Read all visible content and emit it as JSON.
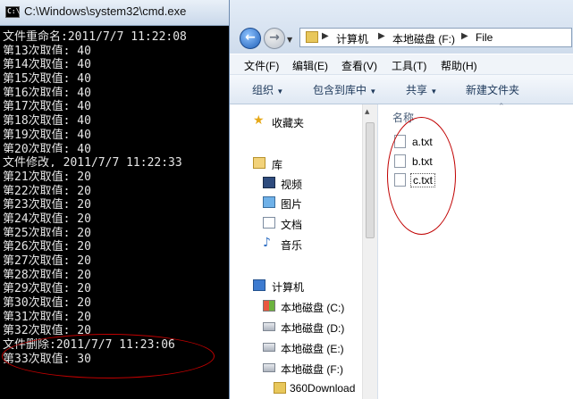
{
  "cmd": {
    "title": "C:\\Windows\\system32\\cmd.exe",
    "icon_text": "C:\\",
    "lines": [
      "文件重命名:2011/7/7 11:22:08",
      "第13次取值: 40",
      "第14次取值: 40",
      "第15次取值: 40",
      "第16次取值: 40",
      "第17次取值: 40",
      "第18次取值: 40",
      "第19次取值: 40",
      "第20次取值: 40",
      "文件修改, 2011/7/7 11:22:33",
      "第21次取值: 20",
      "第22次取值: 20",
      "第23次取值: 20",
      "第24次取值: 20",
      "第25次取值: 20",
      "第26次取值: 20",
      "第27次取值: 20",
      "第28次取值: 20",
      "第29次取值: 20",
      "第30次取值: 20",
      "第31次取值: 20",
      "第32次取值: 20",
      "文件删除:2011/7/7 11:23:06",
      "第33次取值: 30"
    ]
  },
  "explorer": {
    "breadcrumb": [
      "计算机",
      "本地磁盘 (F:)",
      "File"
    ],
    "menu": [
      "文件(F)",
      "编辑(E)",
      "查看(V)",
      "工具(T)",
      "帮助(H)"
    ],
    "toolbar": [
      "组织",
      "包含到库中",
      "共享",
      "新建文件夹"
    ],
    "nav": [
      {
        "label": "收藏夹",
        "icon": "star-icon"
      },
      {
        "label": "库",
        "icon": "library-icon"
      },
      {
        "label": "视频",
        "icon": "video-icon"
      },
      {
        "label": "图片",
        "icon": "picture-icon"
      },
      {
        "label": "文档",
        "icon": "document-icon"
      },
      {
        "label": "音乐",
        "icon": "music-icon"
      },
      {
        "label": "计算机",
        "icon": "computer-icon"
      },
      {
        "label": "本地磁盘 (C:)",
        "icon": "system-drive-icon"
      },
      {
        "label": "本地磁盘 (D:)",
        "icon": "drive-icon"
      },
      {
        "label": "本地磁盘 (E:)",
        "icon": "drive-icon"
      },
      {
        "label": "本地磁盘 (F:)",
        "icon": "drive-icon"
      },
      {
        "label": "360Download",
        "icon": "folder-icon"
      }
    ],
    "column_name": "名称",
    "files": [
      "a.txt",
      "b.txt",
      "c.txt"
    ],
    "selected_file": "c.txt"
  },
  "colors": {
    "annotation": "#c00000",
    "cmd_background": "#000000",
    "cmd_text": "#e6e6e6"
  }
}
